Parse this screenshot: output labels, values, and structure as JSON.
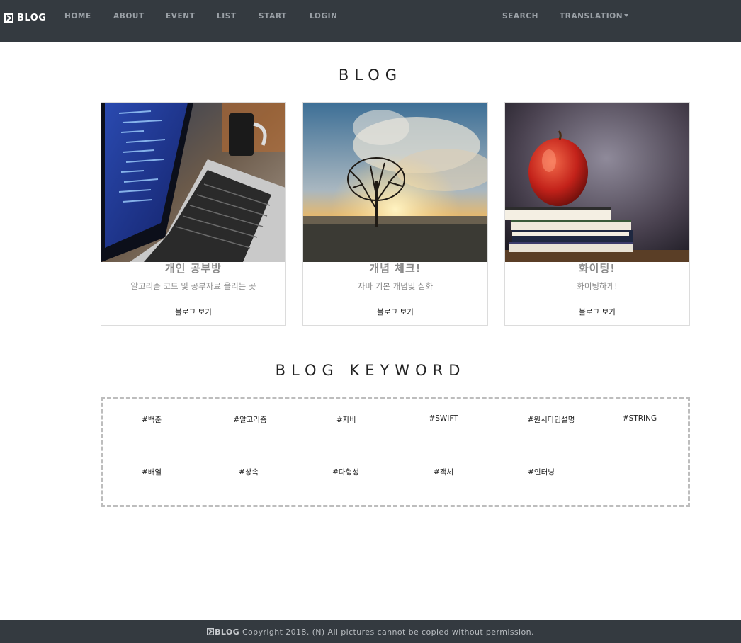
{
  "navbar": {
    "brand_label": "BLOG",
    "brand_icon": "logo-icon",
    "items": [
      {
        "label": "HOME"
      },
      {
        "label": "ABOUT"
      },
      {
        "label": "EVENT"
      },
      {
        "label": "LIST"
      },
      {
        "label": "START"
      },
      {
        "label": "LOGIN"
      }
    ],
    "right_items": [
      {
        "label": "SEARCH"
      },
      {
        "label": "TRANSLATION",
        "has_dropdown": true
      }
    ]
  },
  "blog_section": {
    "title": "BLOG",
    "cards": [
      {
        "image": "laptop-code-photo",
        "title": "개인 공부방",
        "subtitle": "알고리즘 코드 및 공부자료 올리는 곳",
        "link_label": "블로그 보기"
      },
      {
        "image": "tree-sunset-photo",
        "title": "개념 체크!",
        "subtitle": "자바 기본 개념및 심화",
        "link_label": "블로그 보기"
      },
      {
        "image": "apple-books-photo",
        "title": "화이팅!",
        "subtitle": "화이팅하게!",
        "link_label": "블로그 보기"
      }
    ]
  },
  "keyword_section": {
    "title": "BLOG KEYWORD",
    "keywords": [
      {
        "label": "#백준"
      },
      {
        "label": "#알고리즘"
      },
      {
        "label": "#자바"
      },
      {
        "label": "#SWIFT"
      },
      {
        "label": "#원시타입설명"
      },
      {
        "label": "#STRING"
      },
      {
        "label": "#배열"
      },
      {
        "label": "#상속"
      },
      {
        "label": "#다형성"
      },
      {
        "label": "#객체"
      },
      {
        "label": "#인터닝"
      }
    ]
  },
  "footer": {
    "brand_label": "BLOG",
    "text": " Copyright 2018. (N) All pictures cannot be copied without permission."
  },
  "colors": {
    "navbar_bg": "#343a40",
    "nav_text": "#9aa0a6",
    "card_title": "#8a8a8a",
    "keyword_border": "#bdbdbd"
  }
}
